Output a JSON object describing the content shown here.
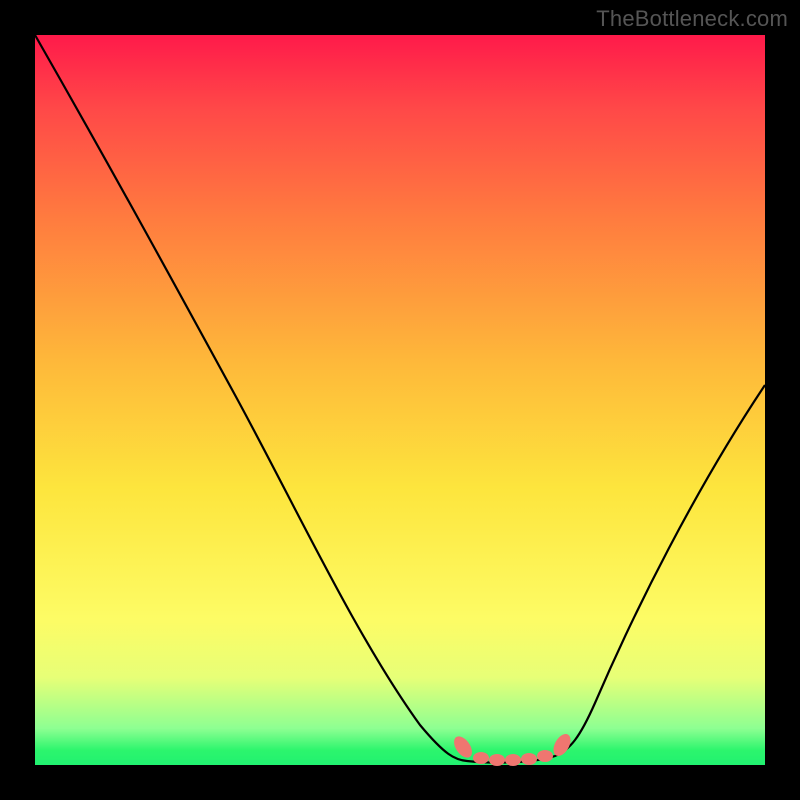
{
  "attribution": "TheBottleneck.com",
  "chart_data": {
    "type": "line",
    "title": "",
    "xlabel": "",
    "ylabel": "",
    "x": [
      0.0,
      0.15,
      0.3,
      0.45,
      0.55,
      0.59,
      0.65,
      0.72,
      0.8,
      0.9,
      1.0
    ],
    "values": [
      1.0,
      0.74,
      0.5,
      0.26,
      0.07,
      0.02,
      0.01,
      0.02,
      0.11,
      0.3,
      0.52
    ],
    "ylim": [
      0,
      1
    ],
    "xlim": [
      0,
      1
    ],
    "minimum_plateau_x": [
      0.59,
      0.72
    ],
    "markers": {
      "type": "beads",
      "positions_x": [
        0.59,
        0.615,
        0.64,
        0.665,
        0.69,
        0.715,
        0.73
      ],
      "positions_y": [
        0.024,
        0.012,
        0.01,
        0.01,
        0.012,
        0.02,
        0.03
      ]
    }
  }
}
